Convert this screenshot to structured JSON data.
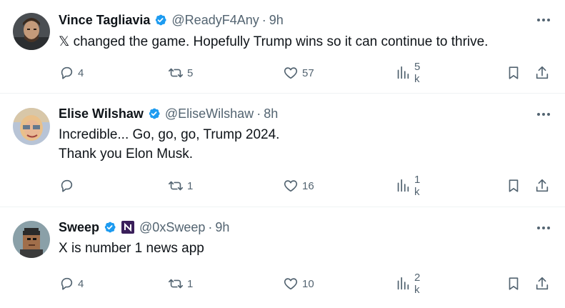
{
  "colors": {
    "verified": "#1d9bf0",
    "secondary_text": "#536471",
    "primary_text": "#0f1419",
    "divider": "#eff3f4"
  },
  "icons": [
    "verified-badge-icon",
    "more-icon",
    "reply-icon",
    "retweet-icon",
    "like-icon",
    "views-icon",
    "bookmark-icon",
    "share-icon"
  ],
  "tweets": [
    {
      "name": "Vince Tagliavia",
      "handle": "@ReadyF4Any",
      "sep": "·",
      "time": "9h",
      "text": "𝕏 changed the game. Hopefully Trump wins so it can continue to thrive.",
      "replies": "4",
      "retweets": "5",
      "likes": "57",
      "views": "5 k"
    },
    {
      "name": "Elise Wilshaw",
      "handle": "@EliseWilshaw",
      "sep": "·",
      "time": "8h",
      "text": "Incredible... Go, go, go, Trump 2024.\nThank you Elon Musk.",
      "replies": "",
      "retweets": "1",
      "likes": "16",
      "views": "1 k"
    },
    {
      "name": "Sweep",
      "handle": "@0xSweep",
      "sep": "·",
      "time": "9h",
      "text": "X is number 1 news app",
      "replies": "4",
      "retweets": "1",
      "likes": "10",
      "views": "2 k"
    }
  ]
}
